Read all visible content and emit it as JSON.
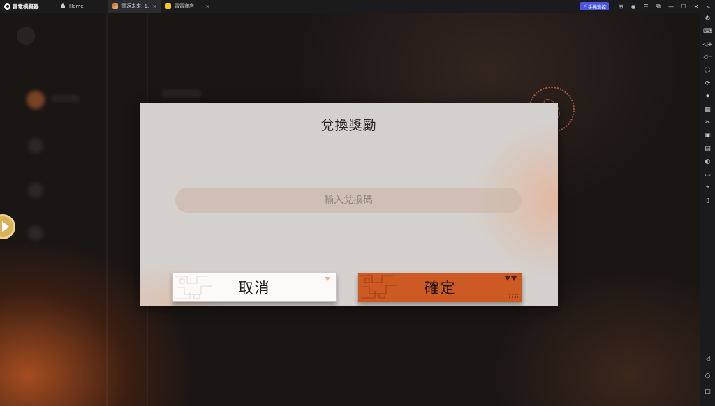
{
  "titlebar": {
    "app_name": "雷電模擬器",
    "tabs": [
      {
        "label": "Home",
        "icon": "home-icon"
      },
      {
        "label": "重返未來: 1...",
        "icon": "game-icon"
      },
      {
        "label": "雷電商店",
        "icon": "store-icon"
      }
    ],
    "remote_label": "手機遙控",
    "window_icons": [
      "gamepad-icon",
      "user-icon",
      "menu-icon",
      "restore-window-icon",
      "minimize-icon",
      "maximize-icon",
      "close-icon",
      "collapse-icon"
    ]
  },
  "sidebar": {
    "icons": [
      "settings-icon",
      "keyboard-icon",
      "volume-up-icon",
      "volume-down-icon",
      "screenshot-icon",
      "rotate-icon",
      "record-icon",
      "apk-icon",
      "cut-icon",
      "multi-instance-icon",
      "macro-icon",
      "sync-icon",
      "folder-icon",
      "location-icon",
      "shake-icon",
      "back-icon",
      "home-circle-icon",
      "recent-apps-icon"
    ]
  },
  "dialog": {
    "title": "兌換獎勵",
    "input_placeholder": "輸入兌換碼",
    "cancel_label": "取消",
    "confirm_label": "確定"
  },
  "colors": {
    "accent": "#cc5a22",
    "dialog_bg": "#d4d0cd",
    "remote_button": "#4a55e6"
  }
}
